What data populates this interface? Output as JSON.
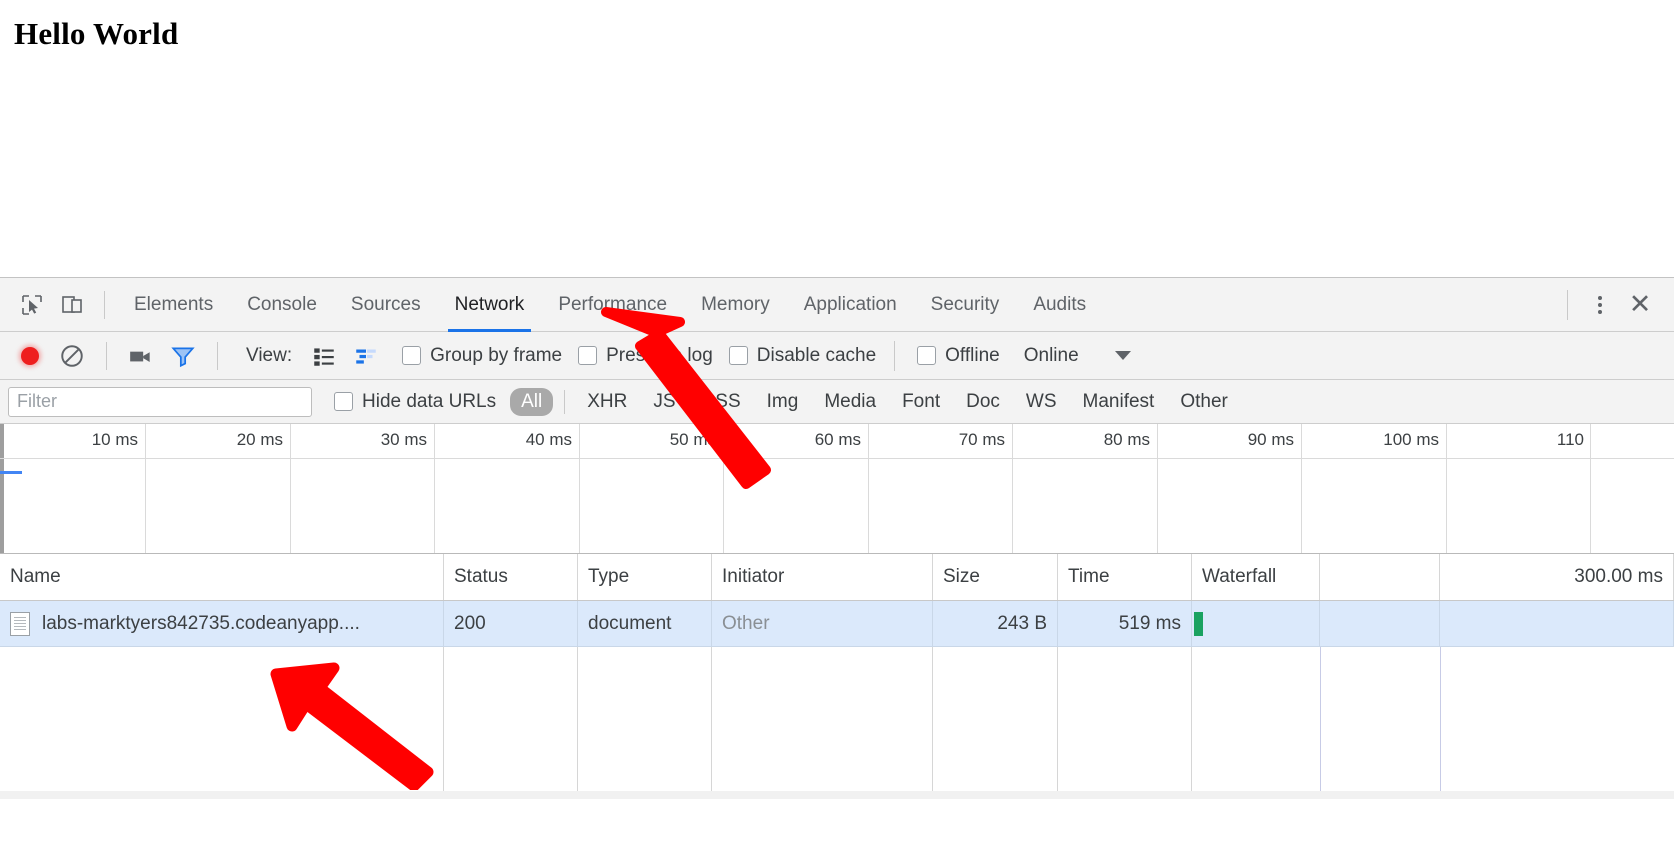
{
  "page": {
    "heading": "Hello World"
  },
  "devtools": {
    "inspect_icon": "inspect-cursor-icon",
    "device_icon": "device-toolbar-icon",
    "tabs": [
      {
        "label": "Elements",
        "active": false
      },
      {
        "label": "Console",
        "active": false
      },
      {
        "label": "Sources",
        "active": false
      },
      {
        "label": "Network",
        "active": true
      },
      {
        "label": "Performance",
        "active": false
      },
      {
        "label": "Memory",
        "active": false
      },
      {
        "label": "Application",
        "active": false
      },
      {
        "label": "Security",
        "active": false
      },
      {
        "label": "Audits",
        "active": false
      }
    ],
    "more_icon": "kebab-menu-icon",
    "close_icon": "close-icon",
    "toolbar": {
      "record_icon": "record-button-icon",
      "clear_icon": "clear-icon",
      "capture_screenshots_icon": "camera-icon",
      "filter_icon": "filter-funnel-icon",
      "view_label": "View:",
      "list_view_icon": "list-view-icon",
      "waterfall_view_icon": "waterfall-view-icon",
      "group_by_frame": "Group by frame",
      "preserve_log": "Preserve log",
      "disable_cache": "Disable cache",
      "offline": "Offline",
      "throttling_value": "Online",
      "throttling_caret_icon": "chevron-down-icon"
    },
    "filterbar": {
      "filter_placeholder": "Filter",
      "filter_value": "",
      "hide_data_urls": "Hide data URLs",
      "types": [
        {
          "label": "All",
          "active": true
        },
        {
          "label": "XHR",
          "active": false
        },
        {
          "label": "JS",
          "active": false
        },
        {
          "label": "CSS",
          "active": false
        },
        {
          "label": "Img",
          "active": false
        },
        {
          "label": "Media",
          "active": false
        },
        {
          "label": "Font",
          "active": false
        },
        {
          "label": "Doc",
          "active": false
        },
        {
          "label": "WS",
          "active": false
        },
        {
          "label": "Manifest",
          "active": false
        },
        {
          "label": "Other",
          "active": false
        }
      ]
    },
    "overview": {
      "ticks": [
        "10 ms",
        "20 ms",
        "30 ms",
        "40 ms",
        "50 ms",
        "60 ms",
        "70 ms",
        "80 ms",
        "90 ms",
        "100 ms",
        "110"
      ]
    },
    "table": {
      "headers": [
        "Name",
        "Status",
        "Type",
        "Initiator",
        "Size",
        "Time",
        "Waterfall"
      ],
      "waterfall_scale": "300.00 ms",
      "rows": [
        {
          "icon": "document-file-icon",
          "name": "labs-marktyers842735.codeanyapp....",
          "status": "200",
          "type": "document",
          "initiator": "Other",
          "size": "243 B",
          "time": "519 ms"
        }
      ]
    }
  },
  "annotations": {
    "arrow_to_network_tab": "red-arrow-icon",
    "arrow_to_request_name": "red-arrow-icon"
  },
  "colors": {
    "accent": "#1a73e8",
    "record": "#ee1e1e",
    "annotation": "#ff0000",
    "row_selected": "#dbe9fb",
    "waterfall_bar": "#1aa260"
  }
}
